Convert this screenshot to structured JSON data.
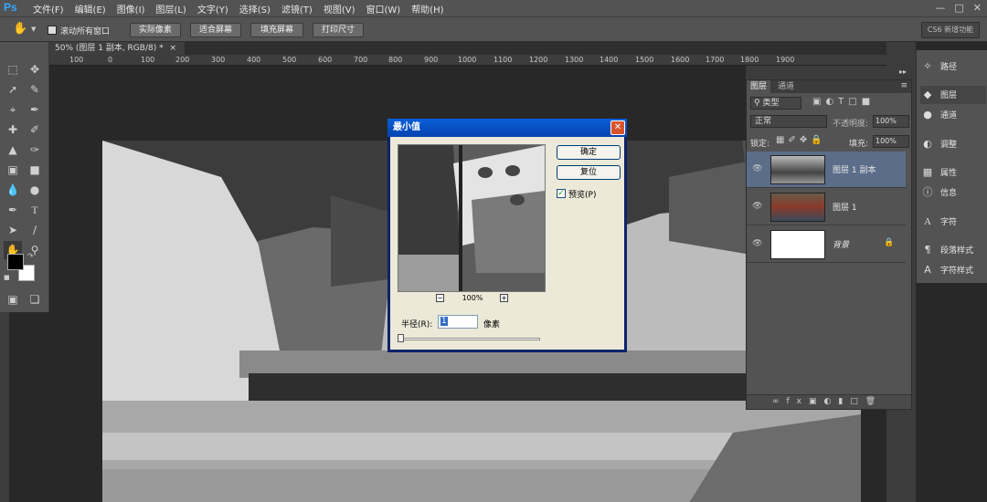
{
  "app": {
    "logo": "Ps"
  },
  "menu": {
    "items": [
      "文件(F)",
      "编辑(E)",
      "图像(I)",
      "图层(L)",
      "文字(Y)",
      "选择(S)",
      "滤镜(T)",
      "视图(V)",
      "窗口(W)",
      "帮助(H)"
    ]
  },
  "options_bar": {
    "scroll_all_label": "滚动所有窗口",
    "actual_pixels": "实际像素",
    "fit_screen": "适合屏幕",
    "fill_screen": "填充屏幕",
    "print_size": "打印尺寸",
    "workspace": "CS6 新增功能"
  },
  "document": {
    "tab_title": "50% (图层 1 副本, RGB/8) *"
  },
  "ruler": {
    "ticks": [
      "100",
      "0",
      "100",
      "200",
      "300",
      "400",
      "500",
      "600",
      "700",
      "800",
      "900",
      "1000",
      "1100",
      "1200",
      "1300",
      "1400",
      "1500",
      "1600",
      "1700",
      "1800",
      "1900"
    ]
  },
  "dialog": {
    "title": "最小值",
    "ok": "确定",
    "reset": "复位",
    "preview_checked": true,
    "preview_label": "预览(P)",
    "zoom": "100%",
    "radius_label": "半径(R):",
    "radius_value": "1",
    "unit": "像素",
    "slider_position": 0
  },
  "layers_panel": {
    "tabs": [
      "图层",
      "通道"
    ],
    "filter_kind": "类型",
    "blend_mode": "正常",
    "opacity_label": "不透明度:",
    "opacity_value": "100%",
    "lock_label": "锁定:",
    "fill_label": "填充:",
    "fill_value": "100%",
    "layers": [
      {
        "name": "图层 1 副本",
        "selected": true
      },
      {
        "name": "图层 1",
        "selected": false
      },
      {
        "name": "背景",
        "selected": false,
        "locked": true
      }
    ]
  },
  "dock": {
    "items": [
      {
        "label": "路径",
        "icon": "path-icon"
      },
      {
        "label": "图层",
        "icon": "layers-icon"
      },
      {
        "label": "通道",
        "icon": "channels-icon"
      },
      {
        "label": "调整",
        "icon": "adjustments-icon"
      },
      {
        "label": "属性",
        "icon": "properties-icon"
      },
      {
        "label": "信息",
        "icon": "info-icon"
      },
      {
        "label": "字符",
        "icon": "character-icon"
      },
      {
        "label": "段落样式",
        "icon": "paragraph-styles-icon"
      },
      {
        "label": "字符样式",
        "icon": "character-styles-icon"
      }
    ]
  },
  "colors": {
    "accent": "#31a8ff",
    "dialog_title": "#0a5fd8",
    "selected_layer": "#5b6d88"
  }
}
